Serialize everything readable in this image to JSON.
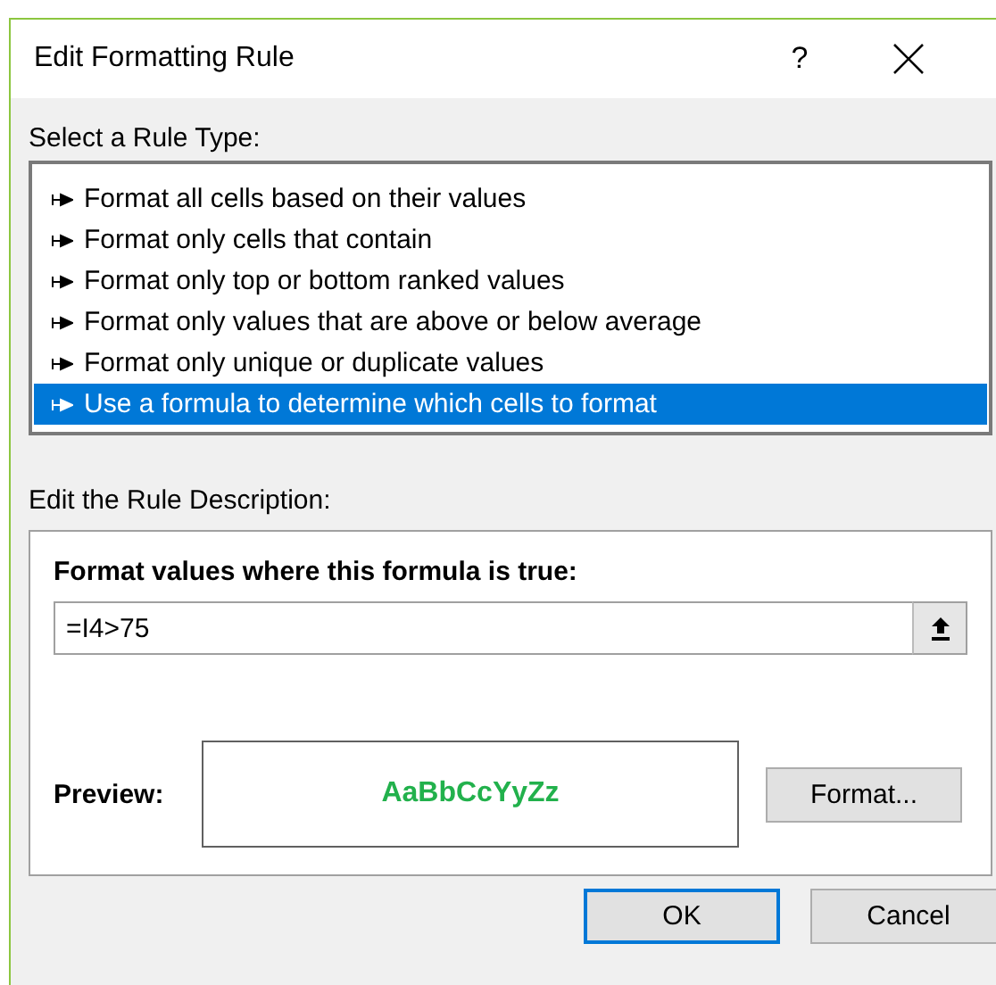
{
  "window": {
    "title": "Edit Formatting Rule",
    "help": "?"
  },
  "rule_type": {
    "label": "Select a Rule Type:",
    "items": [
      {
        "label": "Format all cells based on their values",
        "selected": false
      },
      {
        "label": "Format only cells that contain",
        "selected": false
      },
      {
        "label": "Format only top or bottom ranked values",
        "selected": false
      },
      {
        "label": "Format only values that are above or below average",
        "selected": false
      },
      {
        "label": "Format only unique or duplicate values",
        "selected": false
      },
      {
        "label": "Use a formula to determine which cells to format",
        "selected": true
      }
    ]
  },
  "description": {
    "label": "Edit the Rule Description:",
    "formula_label": "Format values where this formula is true:",
    "formula": "=I4>75",
    "preview_label": "Preview:",
    "preview_text": "AaBbCcYyZz",
    "format_button": "Format..."
  },
  "buttons": [
    {
      "label": "OK",
      "default": true
    },
    {
      "label": "Cancel",
      "default": false
    }
  ]
}
